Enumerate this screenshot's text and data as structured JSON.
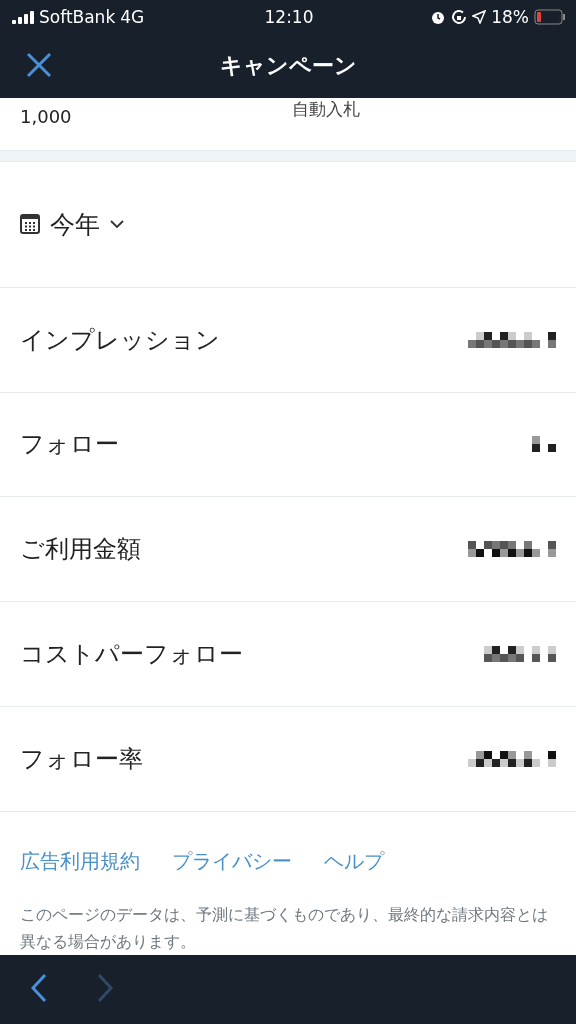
{
  "status_bar": {
    "carrier": "SoftBank",
    "network": "4G",
    "time": "12:10",
    "battery": "18%"
  },
  "nav_bar": {
    "title": "キャンペーン"
  },
  "summary_row": {
    "value": "1,000",
    "bid": "自動入札"
  },
  "date_filter": {
    "label": "今年"
  },
  "metrics": [
    {
      "label": "インプレッション",
      "redacted": true
    },
    {
      "label": "フォロー",
      "redacted": true
    },
    {
      "label": "ご利用金額",
      "redacted": true
    },
    {
      "label": "コストパーフォロー",
      "redacted": true
    },
    {
      "label": "フォロー率",
      "redacted": true
    }
  ],
  "footer_links": [
    "広告利用規約",
    "プライバシー",
    "ヘルプ"
  ],
  "note": "このページのデータは、予測に基づくものであり、最終的な請求内容とは異なる場合があります。",
  "toolbar": {
    "back": {
      "disabled": false
    },
    "forward": {
      "disabled": true
    }
  }
}
